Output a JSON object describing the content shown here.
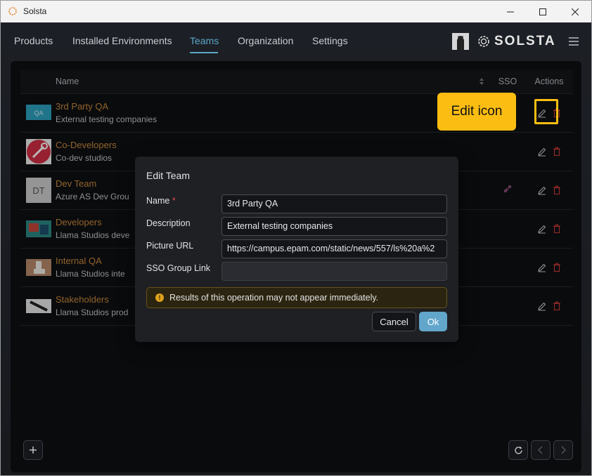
{
  "window": {
    "title": "Solsta"
  },
  "nav": {
    "items": [
      {
        "label": "Products"
      },
      {
        "label": "Installed Environments"
      },
      {
        "label": "Teams"
      },
      {
        "label": "Organization"
      },
      {
        "label": "Settings"
      }
    ],
    "active": "Teams",
    "logo_text": "SOLSTA"
  },
  "table": {
    "headers": {
      "name": "Name",
      "sso": "SSO",
      "actions": "Actions"
    },
    "rows": [
      {
        "name": "3rd Party QA",
        "description": "External testing companies",
        "thumb": "QA",
        "sso": false
      },
      {
        "name": "Co-Developers",
        "description": "Co-dev studios",
        "thumb": "wrench",
        "sso": false
      },
      {
        "name": "Dev Team",
        "description": "Azure AS Dev Grou",
        "thumb": "DT",
        "sso": true
      },
      {
        "name": "Developers",
        "description": "Llama Studios deve",
        "thumb": "image",
        "sso": false
      },
      {
        "name": "Internal QA",
        "description": "Llama Studios inte",
        "thumb": "llama",
        "sso": false
      },
      {
        "name": "Stakeholders",
        "description": "Llama Studios prod",
        "thumb": "pen",
        "sso": false
      }
    ]
  },
  "modal": {
    "title": "Edit Team",
    "fields": {
      "name": {
        "label": "Name",
        "required_mark": "*",
        "value": "3rd Party QA"
      },
      "description": {
        "label": "Description",
        "value": "External testing companies"
      },
      "picture_url": {
        "label": "Picture URL",
        "value": "https://campus.epam.com/static/news/557/ls%20a%2"
      },
      "sso_group_link": {
        "label": "SSO Group Link",
        "value": ""
      }
    },
    "warning": "Results of this operation may not appear immediately.",
    "cancel_label": "Cancel",
    "ok_label": "Ok"
  },
  "callout": {
    "text": "Edit icon"
  },
  "colors": {
    "accent": "#5ba6c9",
    "team_name": "#c98a3e",
    "callout": "#fbbd12",
    "delete": "#d23b3b"
  }
}
